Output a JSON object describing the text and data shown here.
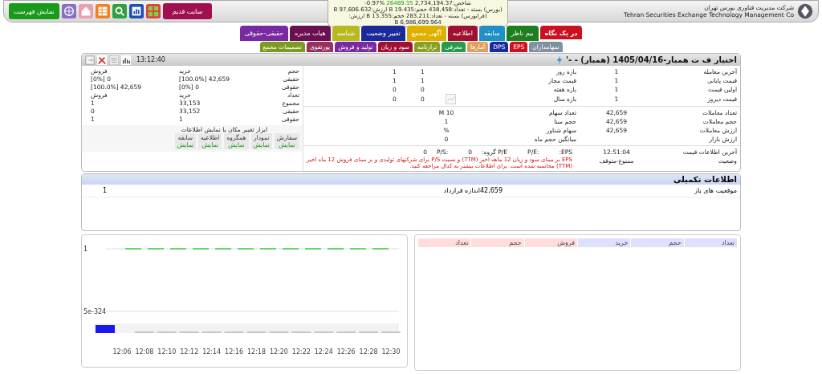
{
  "header": {
    "company_fa": "شرکت مدیریت فناوری بورس تهران",
    "company_en": "Tehran Securities Exchange Technology Management Co",
    "old_site_button": "سایت قدیم",
    "show_list_button": "نمایش فهرست",
    "index": {
      "label": "شاخص:",
      "value": "2,734,194.37",
      "change": "26489.35",
      "percent": "%0.97-"
    },
    "market_lines": [
      "(بورس) بسته - تعداد:438,458 حجم:19.435 B ارزش:97,606.632 B",
      "(فرابورس) بسته - تعداد:283,211 حجم:13.355 B ارزش:",
      "6,986,699.964 B"
    ]
  },
  "tabs_row_1": [
    {
      "label": "در یک نگاه",
      "color": "#cc1020",
      "selected": true
    },
    {
      "label": "بیم ناظر",
      "color": "#1e7f1e",
      "selected": false
    },
    {
      "label": "سابقه",
      "color": "#1f8fc8",
      "selected": false
    },
    {
      "label": "اطلاعیه",
      "color": "#a01030",
      "selected": false
    },
    {
      "label": "آگهی مجمع",
      "color": "#e0b000",
      "selected": false
    },
    {
      "label": "تغییر وضعیت",
      "color": "#1a2a9a",
      "selected": false
    },
    {
      "label": "شناسه",
      "color": "#b8b820",
      "selected": false
    },
    {
      "label": "هیات مدیره",
      "color": "#6a1050",
      "selected": false
    },
    {
      "label": "حقیقی-حقوقی",
      "color": "#7a2aa0",
      "selected": false
    }
  ],
  "tabs_row_2": [
    {
      "label": "سهامداران",
      "color": "#8090a0",
      "selected": false
    },
    {
      "label": "EPS",
      "color": "#d01020",
      "selected": false
    },
    {
      "label": "DPS",
      "color": "#1a2a9a",
      "selected": false
    },
    {
      "label": "آمارها",
      "color": "#e0a060",
      "selected": false
    },
    {
      "label": "معرفی",
      "color": "#2a9a4a",
      "selected": false
    },
    {
      "label": "ترازنامه",
      "color": "#8aa020",
      "selected": false
    },
    {
      "label": "سود و زیان",
      "color": "#a01030",
      "selected": false
    },
    {
      "label": "تولید و فروش",
      "color": "#7a2aa0",
      "selected": false
    },
    {
      "label": "پورتفوی",
      "color": "#9a3060",
      "selected": false
    },
    {
      "label": "تصمیمات مجمع",
      "color": "#7a9a20",
      "selected": false
    }
  ],
  "panel": {
    "title": "اختیار ف ت همبار-1405/04/16 (همبار) - -'",
    "time": "13:12:40"
  },
  "price_rows": [
    {
      "label": "آخرین معامله",
      "value": "1",
      "range_label": "بازه روز",
      "range_values": [
        "1",
        "1"
      ]
    },
    {
      "label": "قیمت پایانی",
      "value": "1",
      "range_label": "قیمت مجاز",
      "range_values": [
        "1",
        "1"
      ]
    },
    {
      "label": "اولین قیمت",
      "value": "1",
      "range_label": "بازه هفته",
      "range_values": [
        "0",
        "0"
      ]
    },
    {
      "label": "قیمت دیروز",
      "value": "1",
      "range_label": "بازه سال",
      "range_values": [
        "0",
        "0"
      ]
    }
  ],
  "trade_rows": [
    {
      "label": "تعداد معاملات",
      "value": "42,659",
      "share_label": "تعداد سهام",
      "share_value": "10 M"
    },
    {
      "label": "حجم معاملات",
      "value": "42,659",
      "share_label": "حجم مبنا",
      "share_value": "1"
    },
    {
      "label": "ارزش معاملات",
      "value": "42,659",
      "share_label": "سهام شناور",
      "share_value": "%"
    },
    {
      "label": "ارزش بازار",
      "share_label": "میانگین حجم ماه",
      "share_value": "0"
    }
  ],
  "status_rows": [
    {
      "label": "آخرین اطلاعات قیمت",
      "value": "12:51:04"
    },
    {
      "label": "وضعیت",
      "value": "ممنوع-متوقف"
    }
  ],
  "ratios": [
    {
      "label": "EPS:"
    },
    {
      "label": ":P/E"
    },
    {
      "label": "P/E گروه:",
      "value": "0"
    },
    {
      "label": ":P/S",
      "value": "0"
    }
  ],
  "ratio_note": "EPS بر مبنای سود و زیان 12 ماهه اخیر (TTM) و نسبت P/S برای شرکتهای تولیدی و بر مبنای فروش 12 ماه اخیر (TTM) محاسبه شده است. برای اطلاعات بیشتر به کدال مراجعه کنید.",
  "client_table": {
    "volume_header": [
      "حجم",
      "خرید",
      "فروش"
    ],
    "volume_rows": [
      {
        "label": "حقیقی",
        "buy": "42,659 [100.0%]",
        "sell": "0 [0%]"
      },
      {
        "label": "حقوقی",
        "buy": "0 [0%]",
        "sell": "42,659 [100.0%]"
      }
    ],
    "count_header": [
      "تعداد",
      "خرید",
      "فروش"
    ],
    "count_rows": [
      {
        "label": "مجموع",
        "buy": "33,153",
        "sell": "1"
      },
      {
        "label": "حقیقی",
        "buy": "33,152",
        "sell": "0"
      },
      {
        "label": "حقوقی",
        "buy": "1",
        "sell": "1"
      }
    ]
  },
  "tools_title": "ابزار تغییر مکان یا نمایش اطلاعات",
  "tools": [
    {
      "label": "سفارش",
      "action": "نمایش"
    },
    {
      "label": "نمودار",
      "action": "نمایش"
    },
    {
      "label": "همگروه",
      "action": "نمایش"
    },
    {
      "label": "اطلاعیه",
      "action": "نمایش"
    },
    {
      "label": "سابقه",
      "action": "نمایش"
    }
  ],
  "supplementary": {
    "title": "اطلاعات تکمیلی",
    "rows": [
      {
        "label": "موقعیت های باز",
        "value": "42,659",
        "label_2": "اندازه قرارداد",
        "value_2": "1"
      }
    ]
  },
  "chart": {
    "chart_data": {
      "type": "line",
      "categories": [
        "12:06",
        "12:08",
        "12:10",
        "12:12",
        "12:14",
        "12:16",
        "12:18",
        "12:20",
        "12:22",
        "12:24",
        "12:26",
        "12:28",
        "12:30"
      ],
      "series": [
        {
          "color": "#44cc44",
          "line_style": "dashed",
          "values": [
            1,
            1,
            1,
            1,
            1,
            1,
            1,
            1,
            1,
            1,
            1,
            1,
            1
          ]
        }
      ],
      "ylim": [
        0,
        1
      ],
      "yticks": [
        {
          "value": 0,
          "label": "5e-324"
        },
        1
      ]
    }
  },
  "order_book": {
    "columns": [
      {
        "label": "تعداد",
        "color": "#dde0ff"
      },
      {
        "label": "حجم",
        "color": "#dde0ff"
      },
      {
        "label": "خرید",
        "color": "#dde0ff"
      },
      {
        "label": "فروش",
        "color": "#ffdddd"
      },
      {
        "label": "حجم",
        "color": "#ffdddd"
      },
      {
        "label": "تعداد",
        "color": "#ffdddd"
      }
    ]
  }
}
